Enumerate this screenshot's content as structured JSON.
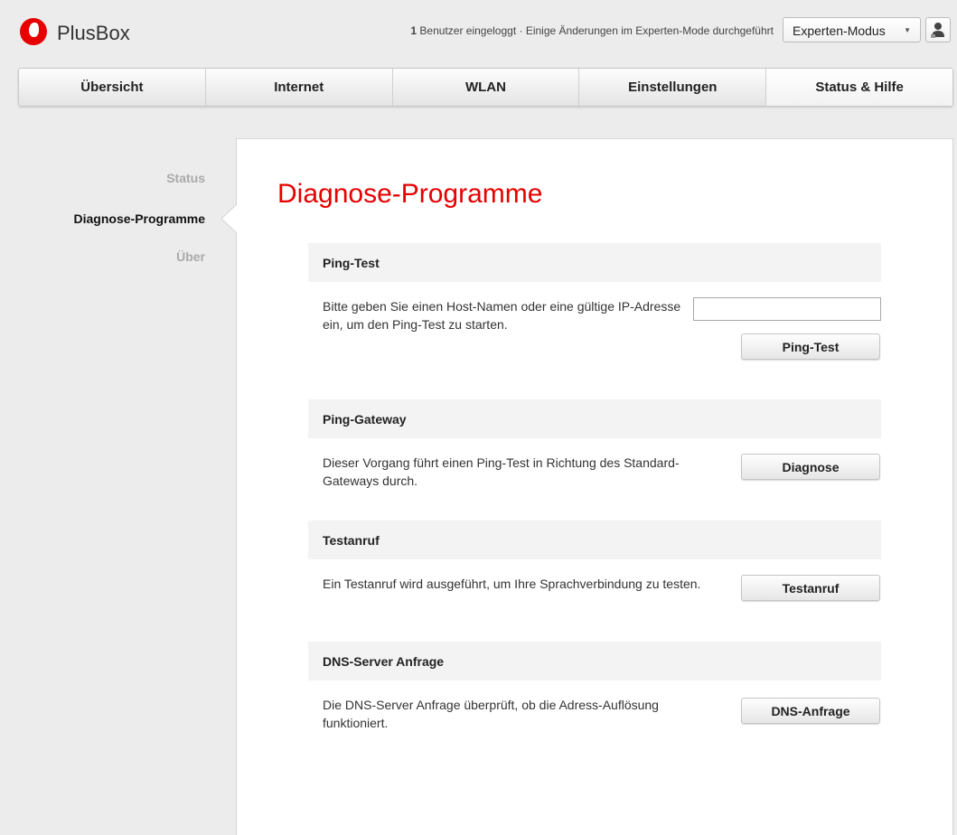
{
  "header": {
    "brand": "PlusBox",
    "status_count": "1",
    "status_text": " Benutzer eingeloggt · Einige Änderungen im Experten-Mode durchgeführt",
    "mode_select": "Experten-Modus",
    "logo_icon": "vodafone-logo",
    "user_icon": "user-icon"
  },
  "tabs": [
    {
      "label": "Übersicht"
    },
    {
      "label": "Internet"
    },
    {
      "label": "WLAN"
    },
    {
      "label": "Einstellungen"
    },
    {
      "label": "Status & Hilfe"
    }
  ],
  "sidebar": {
    "items": [
      {
        "label": "Status"
      },
      {
        "label": "Diagnose-Programme"
      },
      {
        "label": "Über"
      }
    ]
  },
  "main": {
    "title": "Diagnose-Programme",
    "sections": [
      {
        "heading": "Ping-Test",
        "description": "Bitte geben Sie einen Host-Namen oder eine gültige IP-Adresse ein, um den Ping-Test zu starten.",
        "input_value": "",
        "button": "Ping-Test"
      },
      {
        "heading": "Ping-Gateway",
        "description": "Dieser Vorgang führt einen Ping-Test in Richtung des Standard-Gateways durch.",
        "button": "Diagnose"
      },
      {
        "heading": "Testanruf",
        "description": "Ein Testanruf wird ausgeführt, um Ihre Sprachverbindung zu testen.",
        "button": "Testanruf"
      },
      {
        "heading": "DNS-Server Anfrage",
        "description": "Die DNS-Server Anfrage überprüft, ob die Adress-Auflösung funktioniert.",
        "button": "DNS-Anfrage"
      }
    ]
  },
  "colors": {
    "accent": "#e60000",
    "background": "#ececec",
    "section_header": "#f3f3f3"
  }
}
